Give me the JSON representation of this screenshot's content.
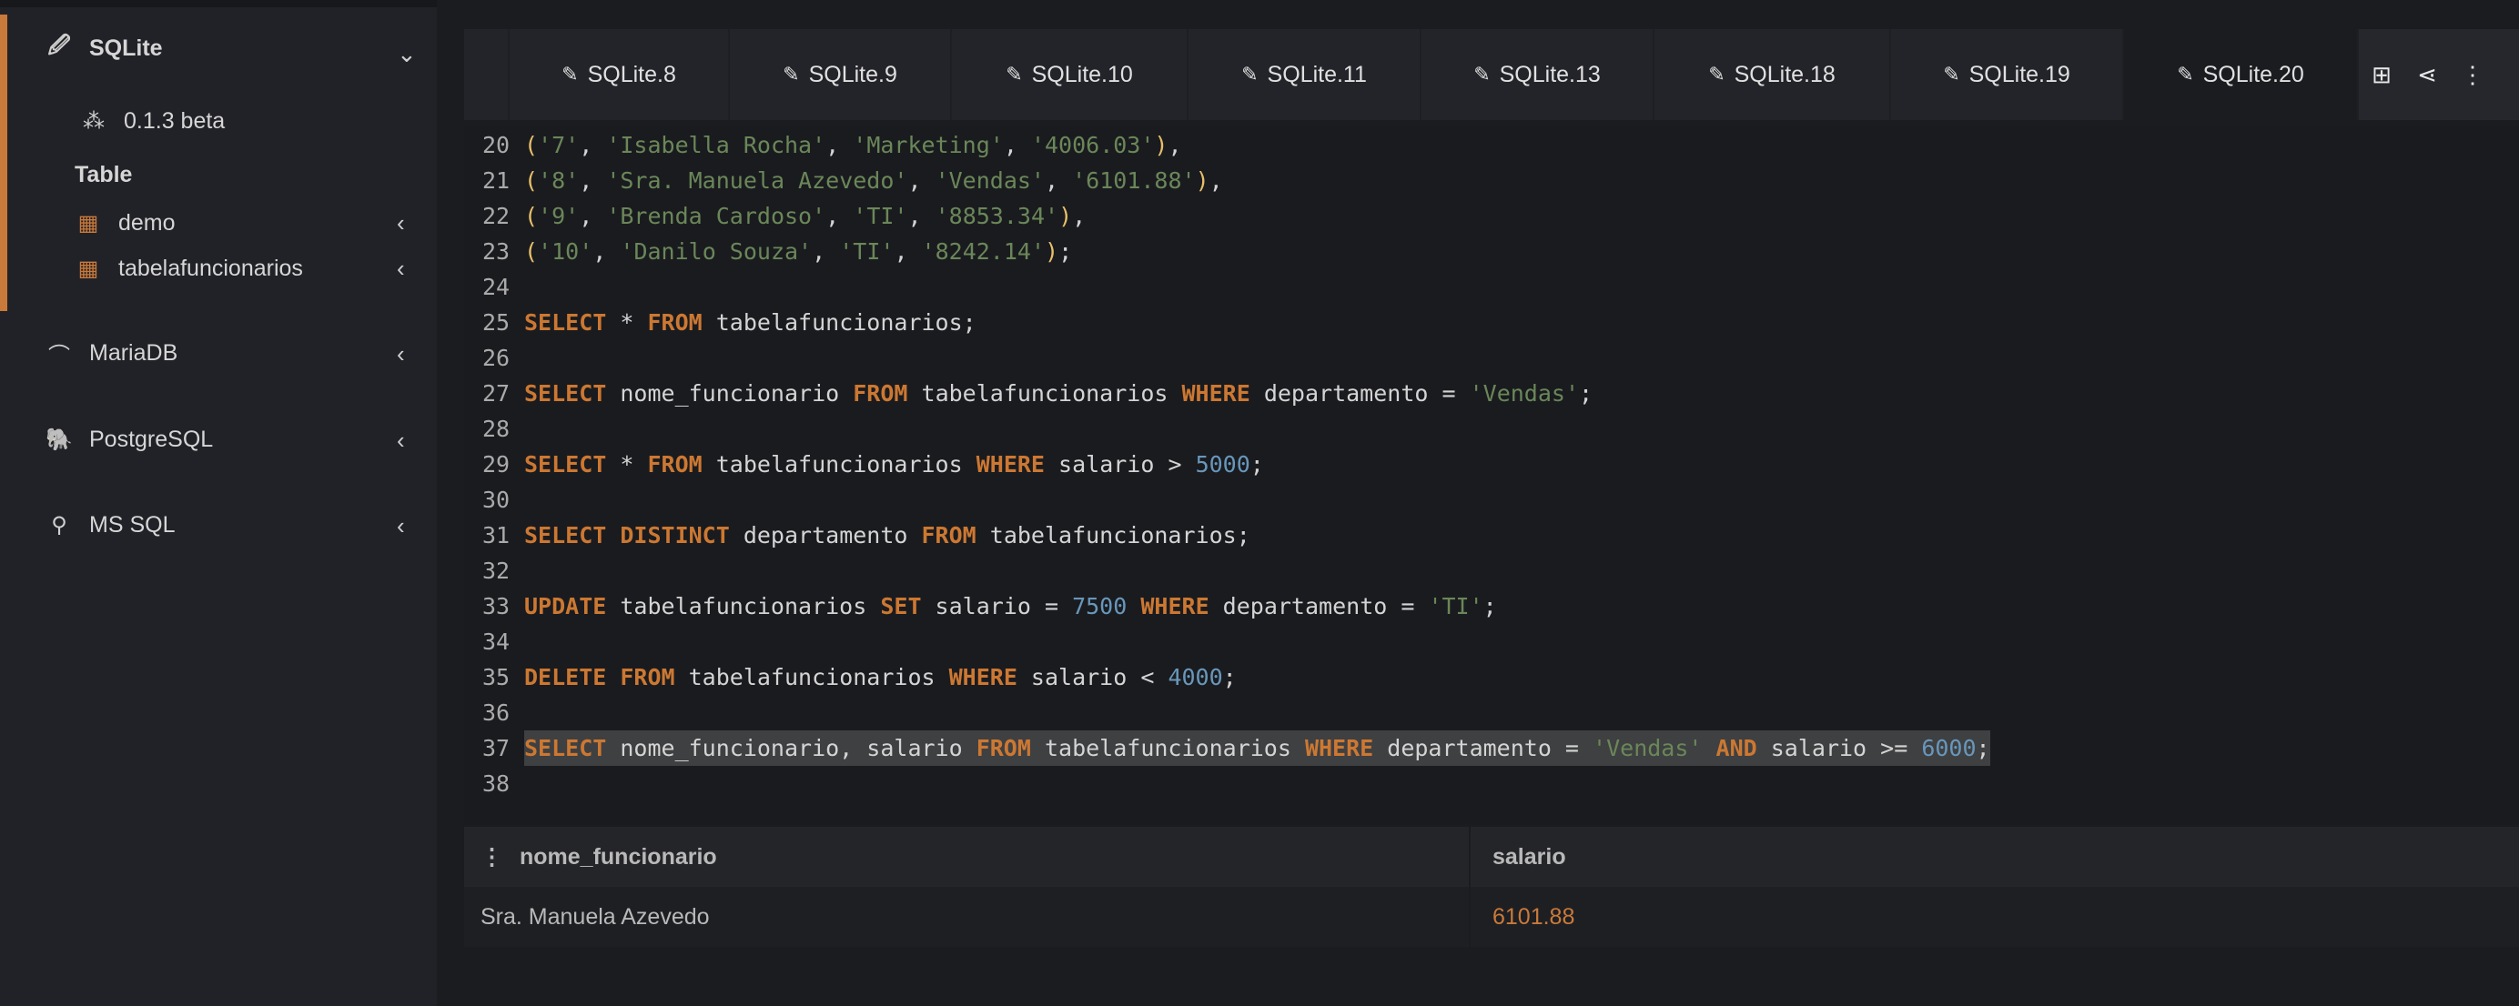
{
  "sidebar": {
    "sqlite": {
      "label": "SQLite",
      "icon": "feather-icon",
      "expanded": true
    },
    "version": "0.1.3 beta",
    "section": "Table",
    "tables": [
      {
        "label": "demo"
      },
      {
        "label": "tabelafuncionarios"
      }
    ],
    "others": [
      {
        "label": "MariaDB",
        "icon": "seal-icon"
      },
      {
        "label": "PostgreSQL",
        "icon": "elephant-icon"
      },
      {
        "label": "MS SQL",
        "icon": "mssql-icon"
      }
    ],
    "accent_color": "#c97a3a"
  },
  "tabs": [
    {
      "label": "SQLite.8"
    },
    {
      "label": "SQLite.9"
    },
    {
      "label": "SQLite.10"
    },
    {
      "label": "SQLite.11"
    },
    {
      "label": "SQLite.13"
    },
    {
      "label": "SQLite.18"
    },
    {
      "label": "SQLite.19"
    },
    {
      "label": "SQLite.20",
      "active": true
    }
  ],
  "toolbar": [
    "plus-square-icon",
    "share-icon",
    "more-vertical-icon"
  ],
  "code": [
    {
      "n": "20",
      "t": [
        [
          "pn",
          "("
        ],
        [
          "str",
          "'7'"
        ],
        [
          "tx",
          ", "
        ],
        [
          "str",
          "'Isabella Rocha'"
        ],
        [
          "tx",
          ", "
        ],
        [
          "str",
          "'Marketing'"
        ],
        [
          "tx",
          ", "
        ],
        [
          "str",
          "'4006.03'"
        ],
        [
          "pn",
          ")"
        ],
        [
          "tx",
          ","
        ]
      ]
    },
    {
      "n": "21",
      "t": [
        [
          "pn",
          "("
        ],
        [
          "str",
          "'8'"
        ],
        [
          "tx",
          ", "
        ],
        [
          "str",
          "'Sra. Manuela Azevedo'"
        ],
        [
          "tx",
          ", "
        ],
        [
          "str",
          "'Vendas'"
        ],
        [
          "tx",
          ", "
        ],
        [
          "str",
          "'6101.88'"
        ],
        [
          "pn",
          ")"
        ],
        [
          "tx",
          ","
        ]
      ]
    },
    {
      "n": "22",
      "t": [
        [
          "pn",
          "("
        ],
        [
          "str",
          "'9'"
        ],
        [
          "tx",
          ", "
        ],
        [
          "str",
          "'Brenda Cardoso'"
        ],
        [
          "tx",
          ", "
        ],
        [
          "str",
          "'TI'"
        ],
        [
          "tx",
          ", "
        ],
        [
          "str",
          "'8853.34'"
        ],
        [
          "pn",
          ")"
        ],
        [
          "tx",
          ","
        ]
      ]
    },
    {
      "n": "23",
      "t": [
        [
          "pn",
          "("
        ],
        [
          "str",
          "'10'"
        ],
        [
          "tx",
          ", "
        ],
        [
          "str",
          "'Danilo Souza'"
        ],
        [
          "tx",
          ", "
        ],
        [
          "str",
          "'TI'"
        ],
        [
          "tx",
          ", "
        ],
        [
          "str",
          "'8242.14'"
        ],
        [
          "pn",
          ")"
        ],
        [
          "tx",
          ";"
        ]
      ]
    },
    {
      "n": "24",
      "t": []
    },
    {
      "n": "25",
      "t": [
        [
          "kw",
          "SELECT"
        ],
        [
          "tx",
          " * "
        ],
        [
          "kw",
          "FROM"
        ],
        [
          "tx",
          " tabelafuncionarios;"
        ]
      ]
    },
    {
      "n": "26",
      "t": []
    },
    {
      "n": "27",
      "t": [
        [
          "kw",
          "SELECT"
        ],
        [
          "tx",
          " nome_funcionario "
        ],
        [
          "kw",
          "FROM"
        ],
        [
          "tx",
          " tabelafuncionarios "
        ],
        [
          "kw",
          "WHERE"
        ],
        [
          "tx",
          " departamento = "
        ],
        [
          "str",
          "'Vendas'"
        ],
        [
          "tx",
          ";"
        ]
      ]
    },
    {
      "n": "28",
      "t": []
    },
    {
      "n": "29",
      "t": [
        [
          "kw",
          "SELECT"
        ],
        [
          "tx",
          " * "
        ],
        [
          "kw",
          "FROM"
        ],
        [
          "tx",
          " tabelafuncionarios "
        ],
        [
          "kw",
          "WHERE"
        ],
        [
          "tx",
          " salario > "
        ],
        [
          "num",
          "5000"
        ],
        [
          "tx",
          ";"
        ]
      ]
    },
    {
      "n": "30",
      "t": []
    },
    {
      "n": "31",
      "t": [
        [
          "kw",
          "SELECT DISTINCT"
        ],
        [
          "tx",
          " departamento "
        ],
        [
          "kw",
          "FROM"
        ],
        [
          "tx",
          " tabelafuncionarios;"
        ]
      ]
    },
    {
      "n": "32",
      "t": []
    },
    {
      "n": "33",
      "t": [
        [
          "kw",
          "UPDATE"
        ],
        [
          "tx",
          " tabelafuncionarios "
        ],
        [
          "kw",
          "SET"
        ],
        [
          "tx",
          " salario = "
        ],
        [
          "num",
          "7500"
        ],
        [
          "tx",
          " "
        ],
        [
          "kw",
          "WHERE"
        ],
        [
          "tx",
          " departamento = "
        ],
        [
          "str",
          "'TI'"
        ],
        [
          "tx",
          ";"
        ]
      ]
    },
    {
      "n": "34",
      "t": []
    },
    {
      "n": "35",
      "t": [
        [
          "kw",
          "DELETE FROM"
        ],
        [
          "tx",
          " tabelafuncionarios "
        ],
        [
          "kw",
          "WHERE"
        ],
        [
          "tx",
          " salario < "
        ],
        [
          "num",
          "4000"
        ],
        [
          "tx",
          ";"
        ]
      ]
    },
    {
      "n": "36",
      "t": []
    },
    {
      "n": "37",
      "hl": true,
      "t": [
        [
          "kw",
          "SELECT"
        ],
        [
          "tx",
          " nome_funcionario, salario "
        ],
        [
          "kw",
          "FROM"
        ],
        [
          "tx",
          " tabelafuncionarios "
        ],
        [
          "kw",
          "WHERE"
        ],
        [
          "tx",
          " departamento = "
        ],
        [
          "str",
          "'Vendas'"
        ],
        [
          "tx",
          " "
        ],
        [
          "kw",
          "AND"
        ],
        [
          "tx",
          " salario >= "
        ],
        [
          "num",
          "6000"
        ],
        [
          "tx",
          ";"
        ]
      ]
    },
    {
      "n": "38",
      "t": []
    }
  ],
  "results": {
    "columns": [
      "nome_funcionario",
      "salario"
    ],
    "rows": [
      [
        "Sra. Manuela Azevedo",
        "6101.88"
      ]
    ],
    "value_color": "#c97a3a"
  }
}
